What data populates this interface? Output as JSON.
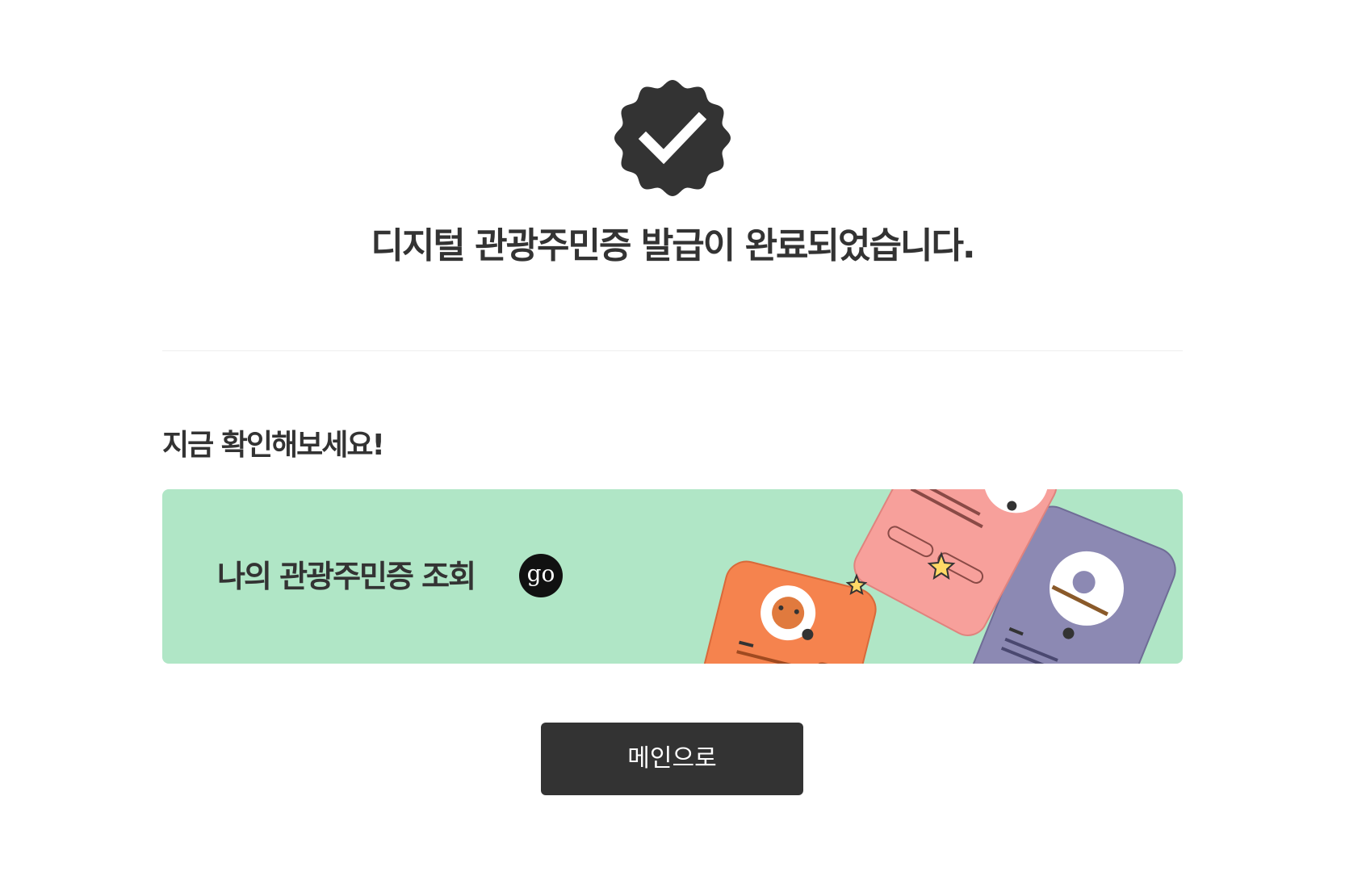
{
  "header": {
    "icon": "verified-check-badge-icon",
    "title": "디지털 관광주민증 발급이 완료되었습니다."
  },
  "section": {
    "subtitle": "지금 확인해보세요!"
  },
  "banner": {
    "label": "나의 관광주민증 조회",
    "go_label": "go",
    "background_color": "#b0e6c6",
    "card_colors": {
      "orange": "#f5834e",
      "pink": "#f7a09b",
      "purple": "#8c89b3"
    }
  },
  "actions": {
    "main_button_label": "메인으로",
    "button_color": "#333333"
  }
}
